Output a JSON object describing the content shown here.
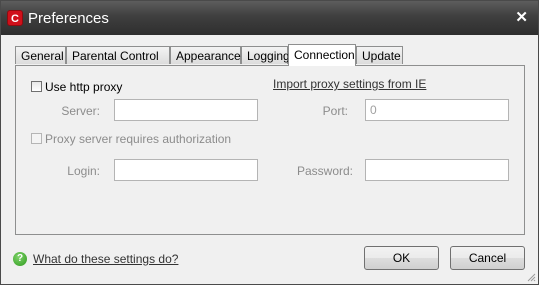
{
  "window": {
    "title": "Preferences",
    "app_icon_letter": "C",
    "close_glyph": "✕"
  },
  "tabs": [
    {
      "label": "General"
    },
    {
      "label": "Parental Control"
    },
    {
      "label": "Appearance"
    },
    {
      "label": "Logging"
    },
    {
      "label": "Connection",
      "active": true
    },
    {
      "label": "Update"
    }
  ],
  "connection": {
    "use_proxy_label": "Use http proxy",
    "use_proxy_checked": false,
    "import_link": "Import proxy settings from IE",
    "server_label": "Server:",
    "server_value": "",
    "port_label": "Port:",
    "port_value": "0",
    "auth_label": "Proxy server requires authorization",
    "auth_checked": false,
    "login_label": "Login:",
    "login_value": "",
    "password_label": "Password:",
    "password_value": ""
  },
  "footer": {
    "help_link": "What do these settings do?",
    "ok_label": "OK",
    "cancel_label": "Cancel"
  },
  "icons": {
    "app": "comodo-logo-icon",
    "help": "help-question-icon",
    "close": "close-icon",
    "grip": "resize-grip-icon"
  },
  "colors": {
    "titlebar": "#3f3f3f",
    "app_icon": "#d0101a",
    "help_icon": "#2f9a1e"
  }
}
